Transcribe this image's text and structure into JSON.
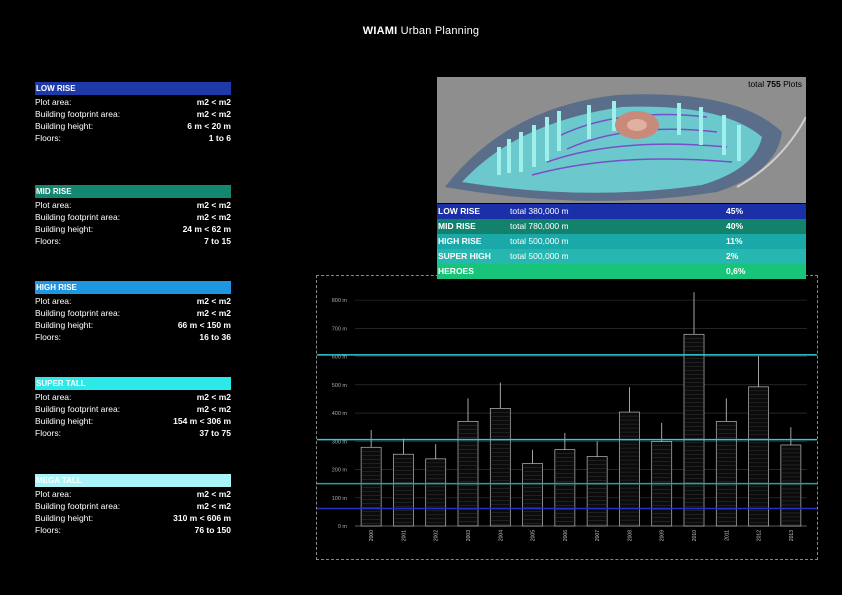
{
  "title": {
    "brand": "WIAMI",
    "subtitle": "Urban Planning"
  },
  "categories": [
    {
      "name": "LOW RISE",
      "color": "#1e3aa8",
      "plot_area": "m2 < m2",
      "footprint": "m2 < m2",
      "height": "6 m < 20 m",
      "floors": "1 to 6"
    },
    {
      "name": "MID RISE",
      "color": "#148770",
      "plot_area": "m2 < m2",
      "footprint": "m2 < m2",
      "height": "24 m < 62 m",
      "floors": "7 to 15"
    },
    {
      "name": "HIGH RISE",
      "color": "#2196e0",
      "plot_area": "m2 < m2",
      "footprint": "m2 < m2",
      "height": "66 m < 150 m",
      "floors": "16 to 36"
    },
    {
      "name": "SUPER TALL",
      "color": "#2de8e8",
      "plot_area": "m2 < m2",
      "footprint": "m2 < m2",
      "height": "154 m < 306 m",
      "floors": "37 to 75"
    },
    {
      "name": "MEGA TALL",
      "color": "#a8f4f8",
      "plot_area": "m2 < m2",
      "footprint": "m2 < m2",
      "height": "310 m < 606 m",
      "floors": "76 to 150"
    }
  ],
  "labels": {
    "plot_area": "Plot area:",
    "footprint": "Building footprint area:",
    "height": "Building height:",
    "floors": "Floors:"
  },
  "aerial": {
    "prefix": "total",
    "count": "755",
    "suffix": "Plots"
  },
  "stats": [
    {
      "name": "LOW RISE",
      "total": "total 380,000 m",
      "pct": "45%",
      "color": "#1a2fa8"
    },
    {
      "name": "MID RISE",
      "total": "total 780,000 m",
      "pct": "40%",
      "color": "#12826c"
    },
    {
      "name": "HIGH RISE",
      "total": "total 500,000 m",
      "pct": "11%",
      "color": "#1aa8a8"
    },
    {
      "name": "SUPER HIGH",
      "total": "total 500,000 m",
      "pct": "2%",
      "color": "#26b8b0"
    },
    {
      "name": "HEROES",
      "total": "",
      "pct": "0,6%",
      "color": "#18c47a"
    }
  ],
  "chart_data": {
    "type": "bar",
    "ylim": [
      0,
      850
    ],
    "yticks": [
      "0 m",
      "100 m",
      "200 m",
      "300 m",
      "400 m",
      "500 m",
      "600 m",
      "700 m",
      "800 m"
    ],
    "x": [
      "2000",
      "2001",
      "2002",
      "2003",
      "2004",
      "2005",
      "2006",
      "2007",
      "2008",
      "2009",
      "2010",
      "2011",
      "2012",
      "2013"
    ],
    "values": [
      340,
      310,
      290,
      452,
      508,
      270,
      330,
      300,
      492,
      365,
      828,
      452,
      601,
      350
    ],
    "reference_lines": [
      {
        "value": 62,
        "color": "#2233cc"
      },
      {
        "value": 150,
        "color": "#1fa89a"
      },
      {
        "value": 306,
        "color": "#36c8d8"
      },
      {
        "value": 606,
        "color": "#36c8d8"
      }
    ]
  }
}
